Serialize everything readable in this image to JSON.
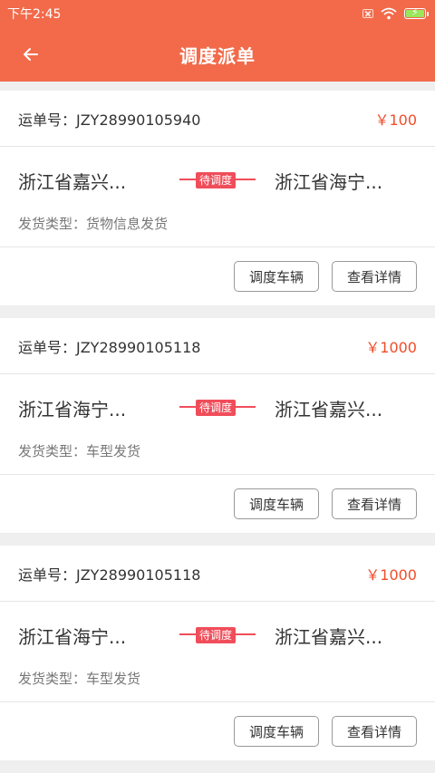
{
  "status_bar": {
    "time": "下午2:45",
    "icons": [
      "sim-off-icon",
      "wifi-icon",
      "battery-charging-icon"
    ]
  },
  "app_bar": {
    "title": "调度派单",
    "back_icon": "arrow-left-icon"
  },
  "colors": {
    "brand": "#f26a4a",
    "price": "#f04d2a",
    "badge": "#f04d5a"
  },
  "orders": [
    {
      "no_label": "运单号：JZY28990105940",
      "price": "￥100",
      "from": "浙江省嘉兴...",
      "status": "待调度",
      "to": "浙江省海宁...",
      "type_label": "发货类型：货物信息发货",
      "dispatch_label": "调度车辆",
      "detail_label": "查看详情"
    },
    {
      "no_label": "运单号：JZY28990105118",
      "price": "￥1000",
      "from": "浙江省海宁...",
      "status": "待调度",
      "to": "浙江省嘉兴...",
      "type_label": "发货类型：车型发货",
      "dispatch_label": "调度车辆",
      "detail_label": "查看详情"
    },
    {
      "no_label": "运单号：JZY28990105118",
      "price": "￥1000",
      "from": "浙江省海宁...",
      "status": "待调度",
      "to": "浙江省嘉兴...",
      "type_label": "发货类型：车型发货",
      "dispatch_label": "调度车辆",
      "detail_label": "查看详情"
    }
  ]
}
